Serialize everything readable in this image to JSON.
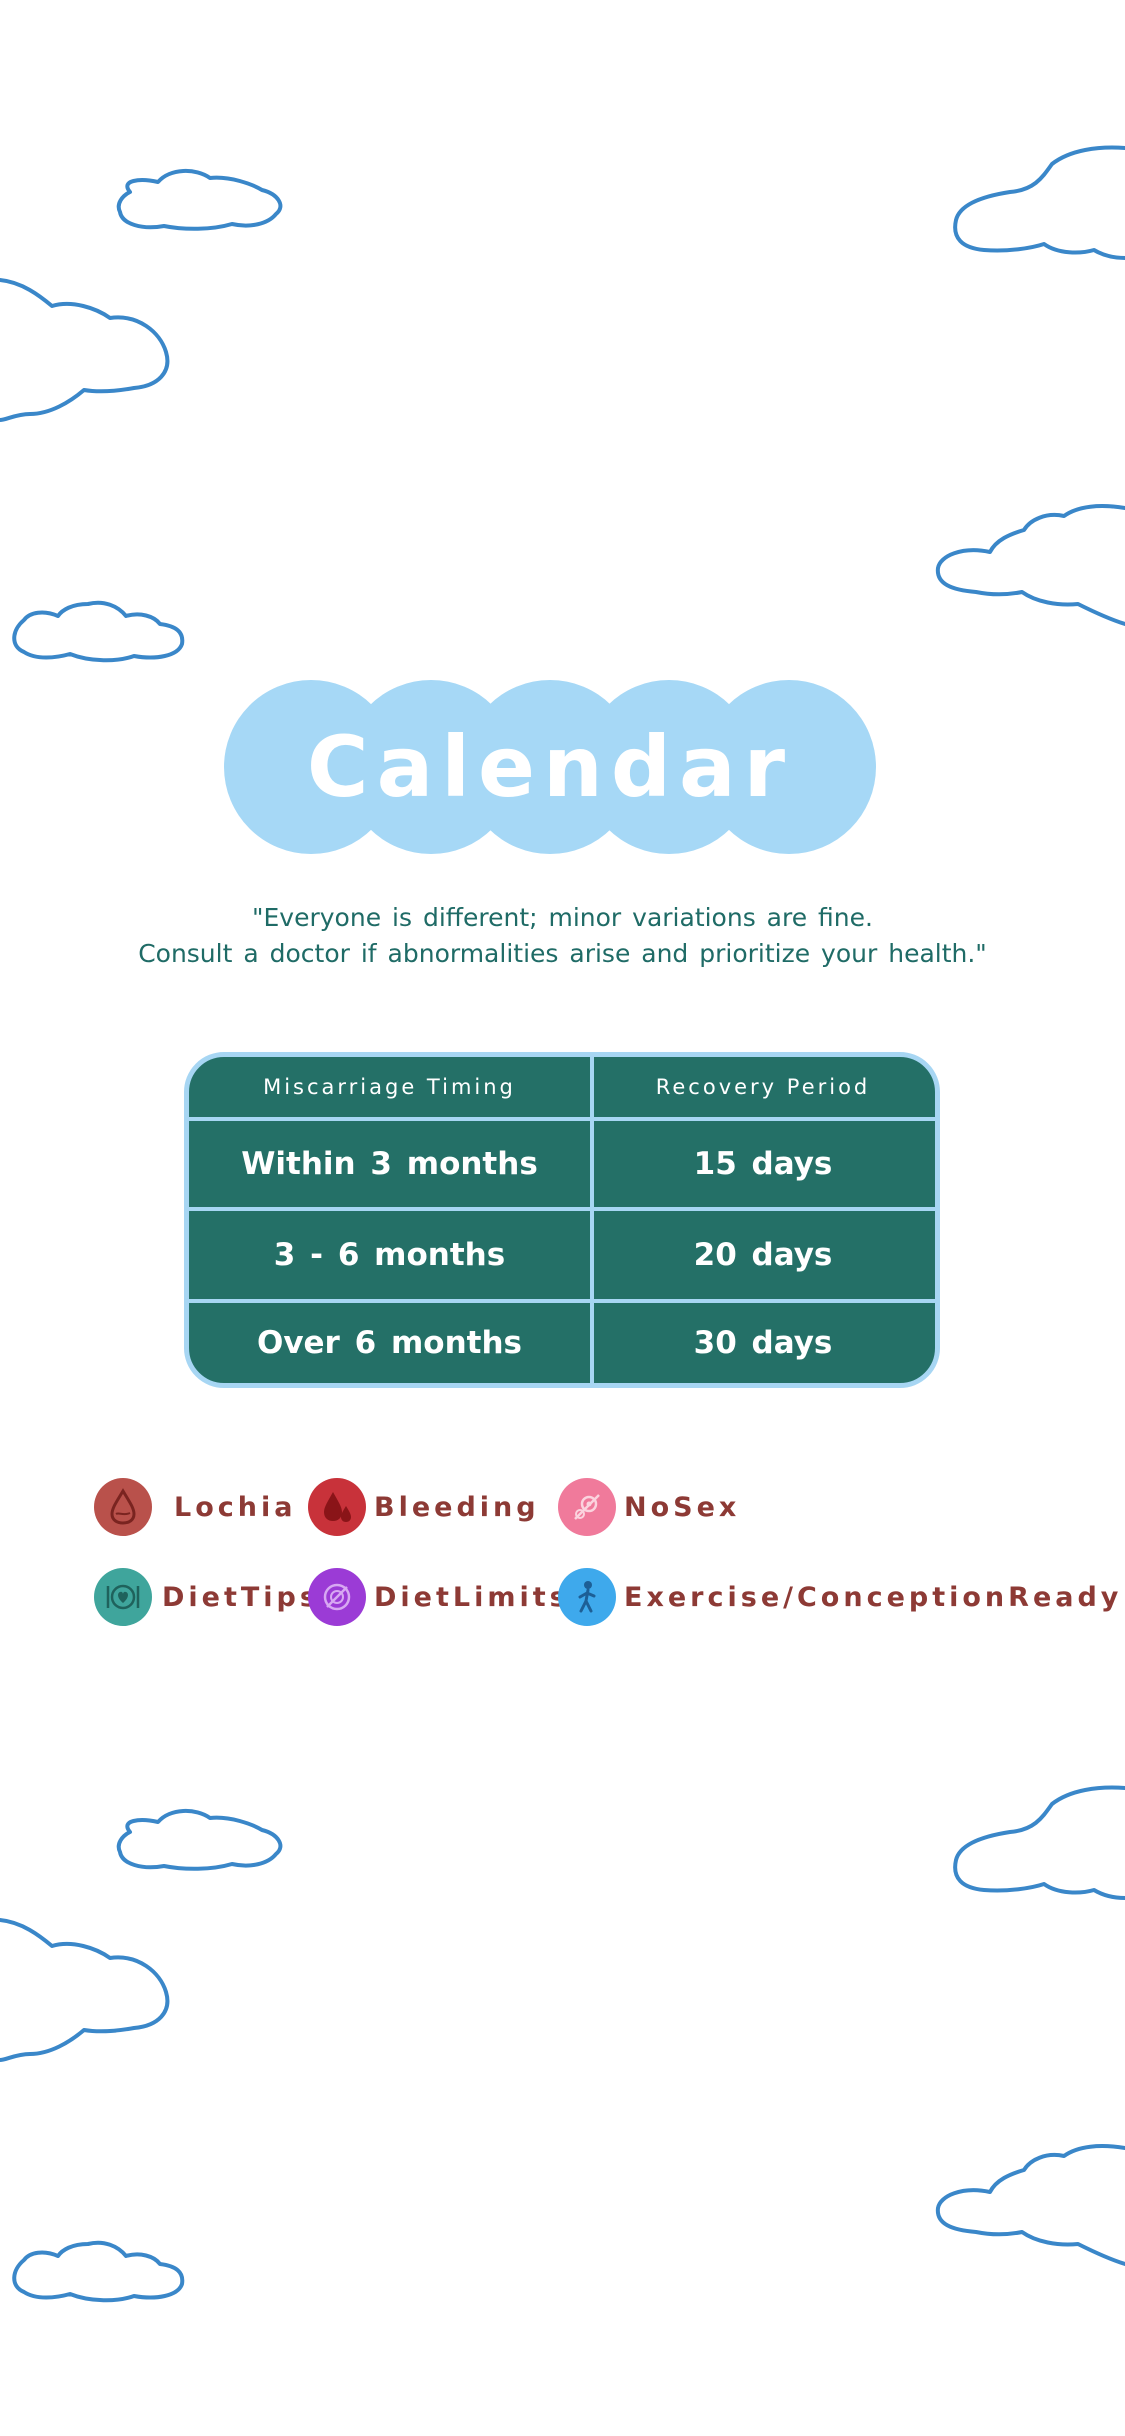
{
  "title": "Calendar",
  "quote": {
    "line1": "\"Everyone is different; minor variations are fine.",
    "line2": "Consult a doctor if abnormalities arise and prioritize your health.\""
  },
  "table": {
    "headers": [
      "Miscarriage Timing",
      "Recovery Period"
    ],
    "rows": [
      [
        "Within 3 months",
        "15 days"
      ],
      [
        "3 - 6 months",
        "20 days"
      ],
      [
        "Over 6 months",
        "30 days"
      ]
    ]
  },
  "legend": [
    {
      "label": "Lochia",
      "icon": "drop-outline-icon",
      "color": "#b9514b"
    },
    {
      "label": "Bleeding",
      "icon": "blood-drops-icon",
      "color": "#c8323a"
    },
    {
      "label": "NoSex",
      "icon": "no-sex-icon",
      "color": "#f07a9b"
    },
    {
      "label": "DietTips",
      "icon": "diet-tips-icon",
      "color": "#3fa59c"
    },
    {
      "label": "DietLimits",
      "icon": "diet-limits-icon",
      "color": "#9b3bd6"
    },
    {
      "label": "Exercise/ConceptionReady",
      "icon": "exercise-icon",
      "color": "#3ea9ec"
    }
  ],
  "colors": {
    "title_bubble": "#a6d8f6",
    "table_bg": "#247067",
    "table_border": "#a7d6f3",
    "quote_text": "#1f6b66",
    "legend_text": "#8d3a35",
    "cloud_stroke": "#3a87c9"
  }
}
